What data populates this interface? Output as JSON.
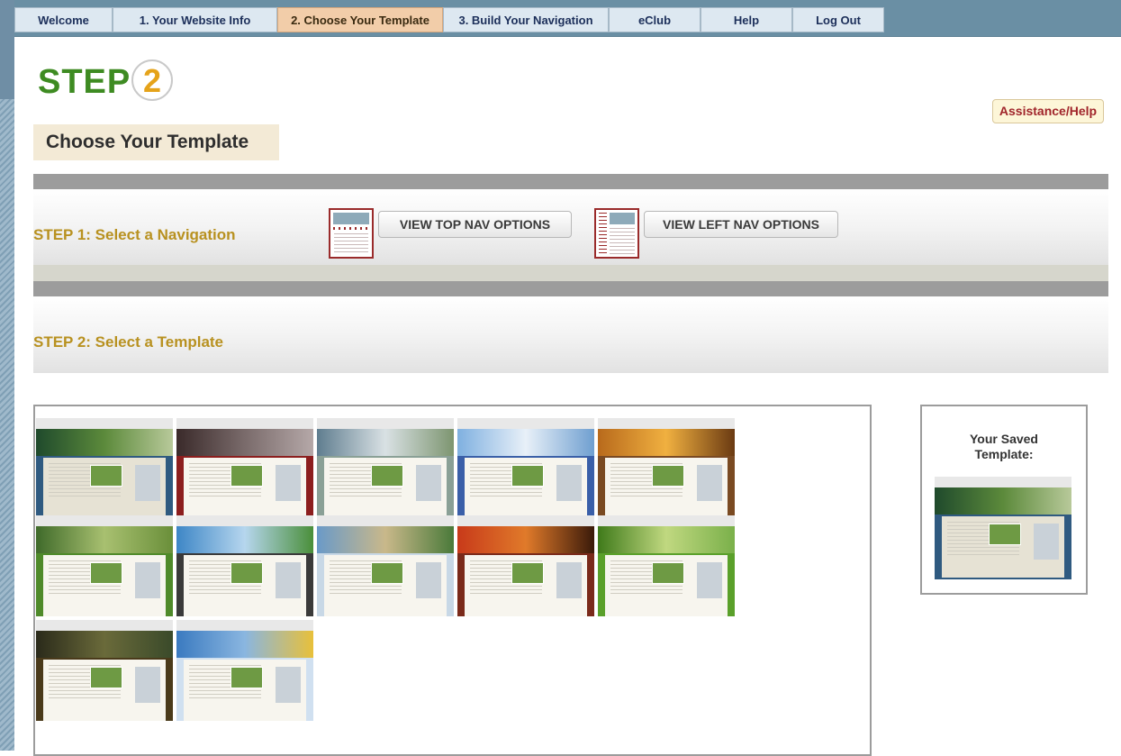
{
  "nav": {
    "tabs": [
      {
        "label": "Welcome"
      },
      {
        "label": "1. Your Website Info"
      },
      {
        "label": "2. Choose Your Template",
        "active": true
      },
      {
        "label": "3. Build Your Navigation"
      },
      {
        "label": "eClub"
      },
      {
        "label": "Help"
      },
      {
        "label": "Log Out"
      }
    ]
  },
  "logo": {
    "word": "STEP",
    "number": "2"
  },
  "assist_label": "Assistance/Help",
  "page_title": "Choose Your Template",
  "step1": {
    "label": "STEP 1: Select a Navigation",
    "top_nav_button": "VIEW TOP NAV OPTIONS",
    "left_nav_button": "VIEW LEFT NAV OPTIONS"
  },
  "step2": {
    "label": "STEP 2: Select a Template"
  },
  "templates": [
    {
      "icon": "template-thumbnail-blue-golf"
    },
    {
      "icon": "template-thumbnail-red-golf"
    },
    {
      "icon": "template-thumbnail-teal-golf"
    },
    {
      "icon": "template-thumbnail-sky-golf"
    },
    {
      "icon": "template-thumbnail-sunset-golf"
    },
    {
      "icon": "template-thumbnail-green-golf"
    },
    {
      "icon": "template-thumbnail-dark-golf"
    },
    {
      "icon": "template-thumbnail-beach-golf"
    },
    {
      "icon": "template-thumbnail-crimson-golf"
    },
    {
      "icon": "template-thumbnail-lime-golf"
    },
    {
      "icon": "template-thumbnail-forest-golf"
    },
    {
      "icon": "template-thumbnail-sunflower-golf"
    }
  ],
  "saved": {
    "label_line1": "Your Saved",
    "label_line2": "Template:"
  },
  "colors": {
    "topnav_bg": "#6a8fa4",
    "tab_bg": "#dde8f1",
    "tab_active_bg": "#f2cda9",
    "step_green": "#3e8b22",
    "step_gold": "#e5a31a",
    "step_label": "#b89120",
    "assist_red": "#a0242a"
  }
}
